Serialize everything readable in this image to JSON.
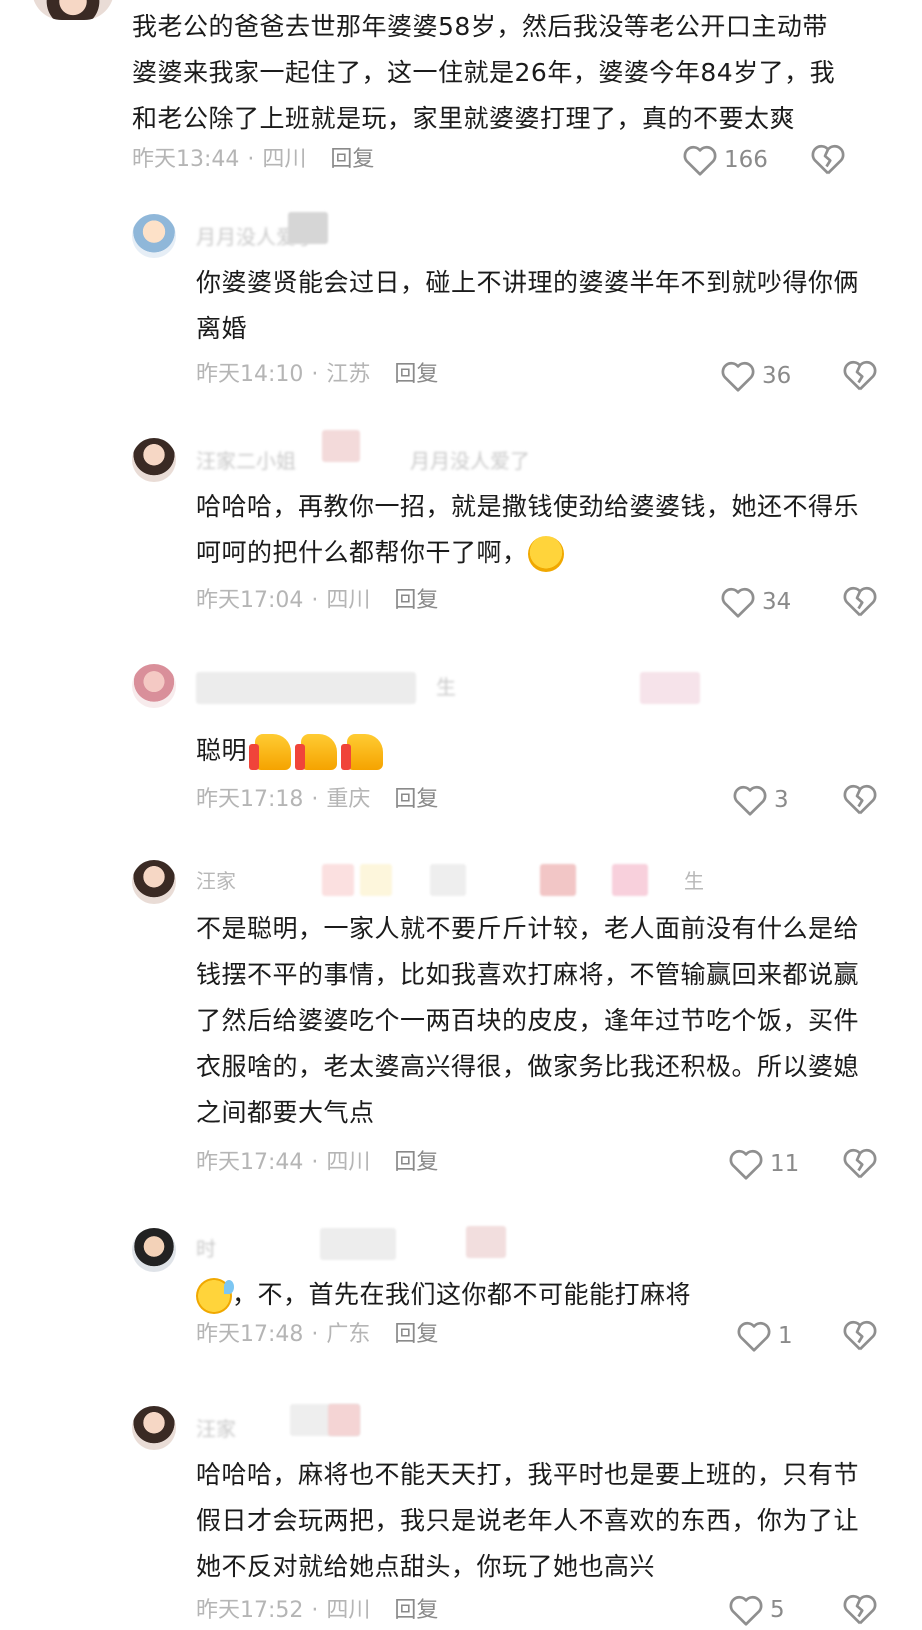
{
  "comments": [
    {
      "username": "",
      "text": "我老公的爸爸去世那年婆婆58岁，然后我没等老公开口主动带婆婆来我家一起住了，这一住就是26年，婆婆今年84岁了，我和老公除了上班就是玩，家里就婆婆打理了，真的不要太爽",
      "time": "昨天13:44",
      "location": "四川",
      "reply": "回复",
      "likes": "166"
    },
    {
      "username": "月月没人爱了",
      "text": "你婆婆贤能会过日，碰上不讲理的婆婆半年不到就吵得你俩离婚",
      "time": "昨天14:10",
      "location": "江苏",
      "reply": "回复",
      "likes": "36"
    },
    {
      "username": "汪家二小姐",
      "reply_to": "月月没人爱了",
      "text": "哈哈哈，再教你一招，就是撒钱使劲给婆婆钱，她还不得乐呵呵的把什么都帮你干了啊，",
      "time": "昨天17:04",
      "location": "四川",
      "reply": "回复",
      "likes": "34"
    },
    {
      "username": "生",
      "text": "聪明",
      "time": "昨天17:18",
      "location": "重庆",
      "reply": "回复",
      "likes": "3"
    },
    {
      "username": "汪家",
      "username_tail": "生",
      "text": "不是聪明，一家人就不要斤斤计较，老人面前没有什么是给钱摆不平的事情，比如我喜欢打麻将，不管输赢回来都说赢了然后给婆婆吃个一两百块的皮皮，逢年过节吃个饭，买件衣服啥的，老太婆高兴得很，做家务比我还积极。所以婆媳之间都要大气点",
      "time": "昨天17:44",
      "location": "四川",
      "reply": "回复",
      "likes": "11"
    },
    {
      "username": "时",
      "text": "，不，首先在我们这你都不可能能打麻将",
      "time": "昨天17:48",
      "location": "广东",
      "reply": "回复",
      "likes": "1"
    },
    {
      "username": "汪家",
      "text": "哈哈哈，麻将也不能天天打，我平时也是要上班的，只有节假日才会玩两把，我只是说老年人不喜欢的东西，你为了让她不反对就给她点甜头，你玩了她也高兴",
      "time": "昨天17:52",
      "location": "四川",
      "reply": "回复",
      "likes": "5"
    }
  ],
  "icons": {
    "like": "heart-outline-icon",
    "dislike": "broken-heart-icon"
  },
  "colors": {
    "meta": "#b5b5b5",
    "reply": "#8a8a8a",
    "icon": "#8f8f8f"
  }
}
